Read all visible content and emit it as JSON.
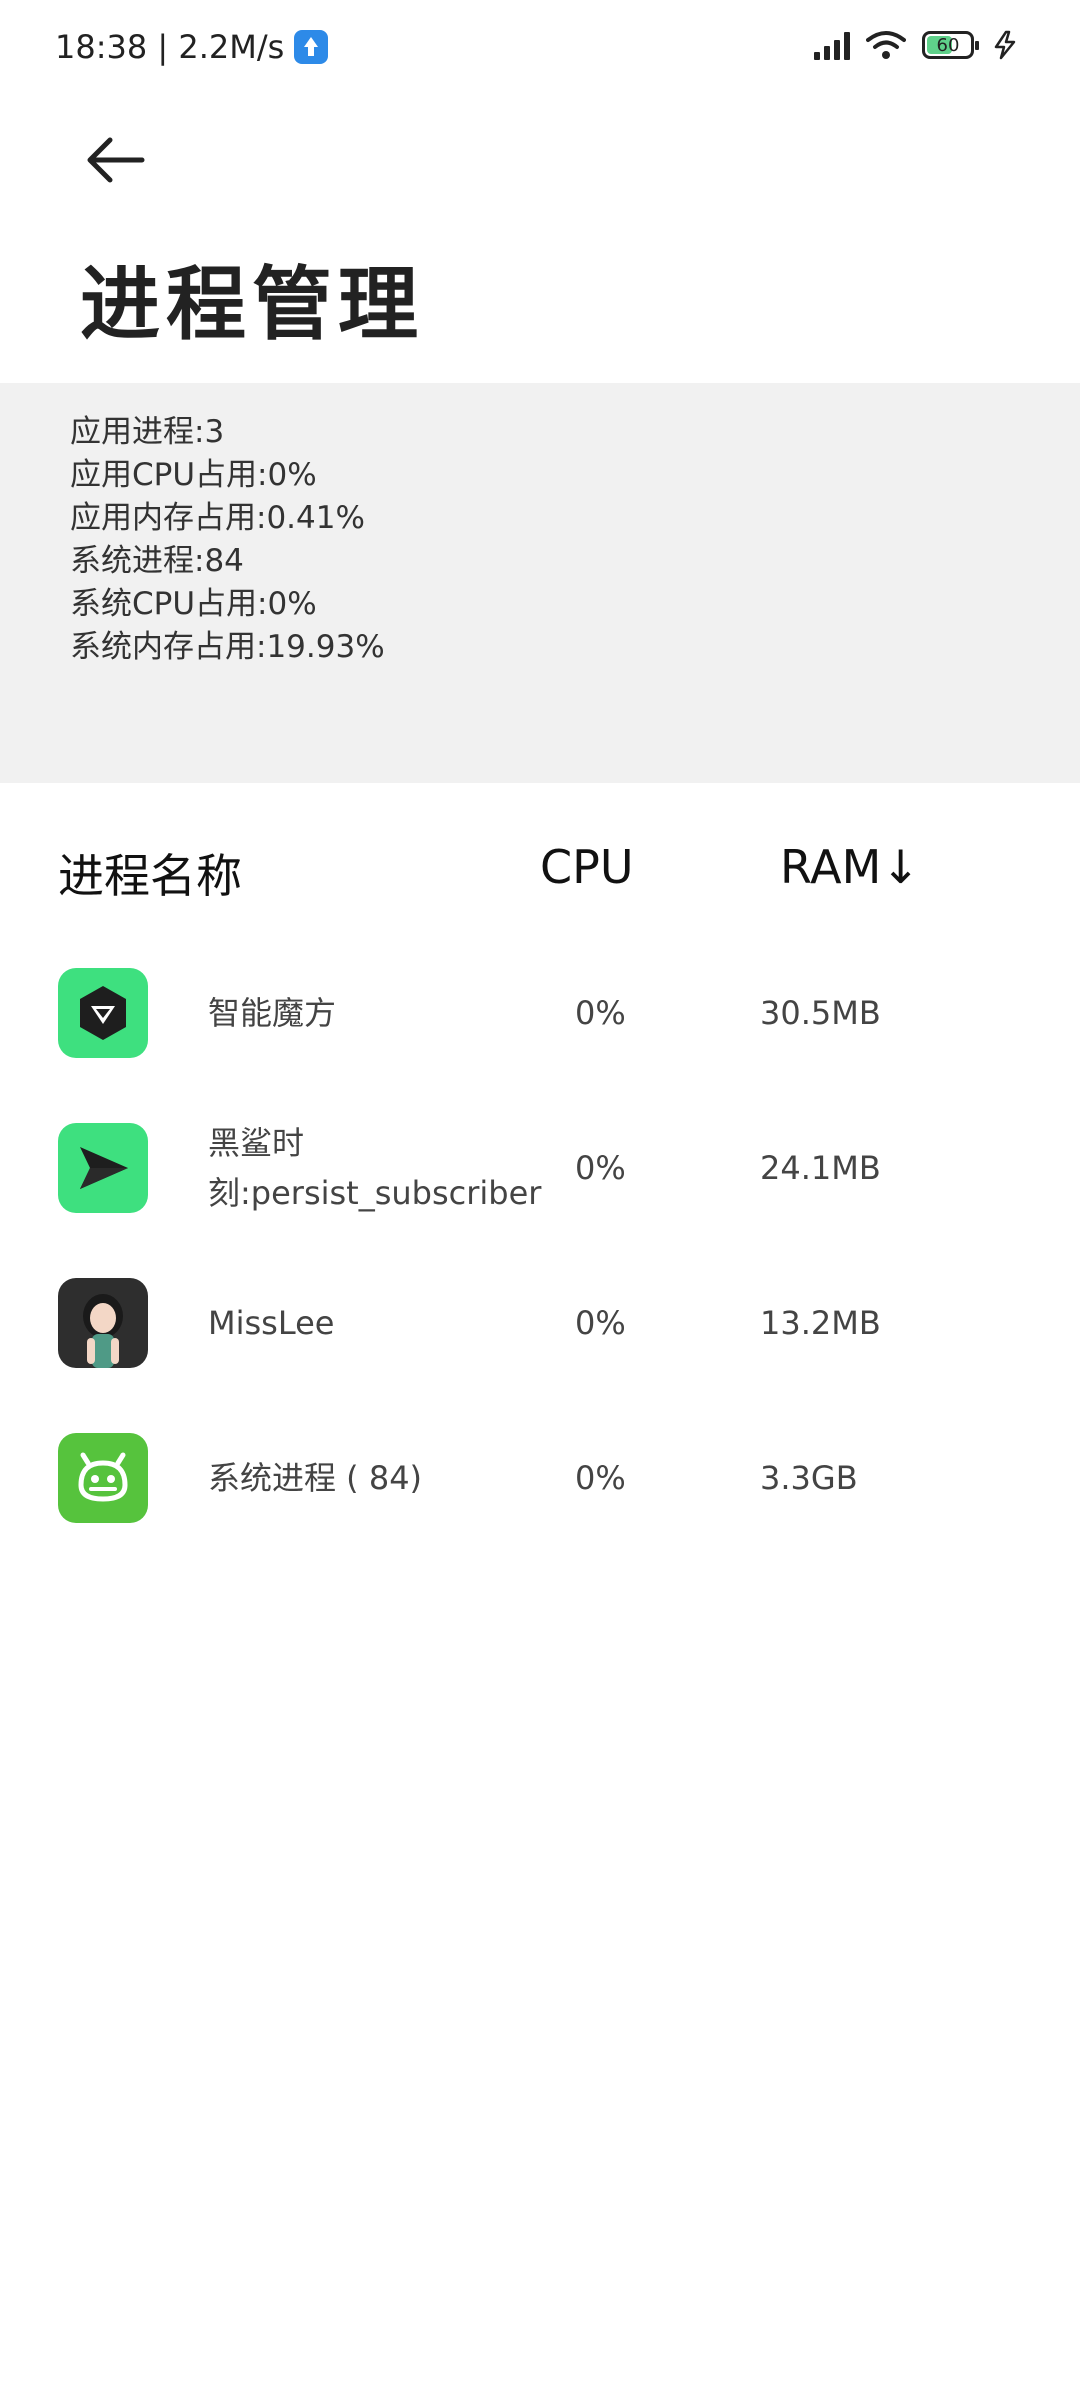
{
  "status_bar": {
    "time_speed": "18:38 | 2.2M/s",
    "battery_level": "60",
    "battery_fill_percent": 60,
    "icons": [
      "upload-icon",
      "hd-signal-icon",
      "wifi-icon",
      "battery-icon",
      "charging-icon"
    ]
  },
  "header": {
    "back_icon": "arrow-left-icon",
    "title": "进程管理"
  },
  "summary": {
    "lines": [
      "应用进程:3",
      "应用CPU占用:0%",
      "应用内存占用:0.41%",
      "系统进程:84",
      "系统CPU占用:0%",
      "系统内存占用:19.93%"
    ]
  },
  "table": {
    "columns": {
      "name": "进程名称",
      "cpu": "CPU",
      "ram": "RAM↓"
    },
    "rows": [
      {
        "name": "智能魔方",
        "cpu": "0%",
        "ram": "30.5MB",
        "icon": "cube-app-icon",
        "icon_color": "#3ee07f"
      },
      {
        "name": "黑鲨时刻:persist_subscriber",
        "cpu": "0%",
        "ram": "24.1MB",
        "icon": "paper-plane-app-icon",
        "icon_color": "#3ee07f"
      },
      {
        "name": "MissLee",
        "cpu": "0%",
        "ram": "13.2MB",
        "icon": "avatar-app-icon",
        "icon_color": "#2e2e2e"
      },
      {
        "name": "系统进程 ( 84)",
        "cpu": "0%",
        "ram": "3.3GB",
        "icon": "android-icon",
        "icon_color": "#56c33d"
      }
    ]
  }
}
